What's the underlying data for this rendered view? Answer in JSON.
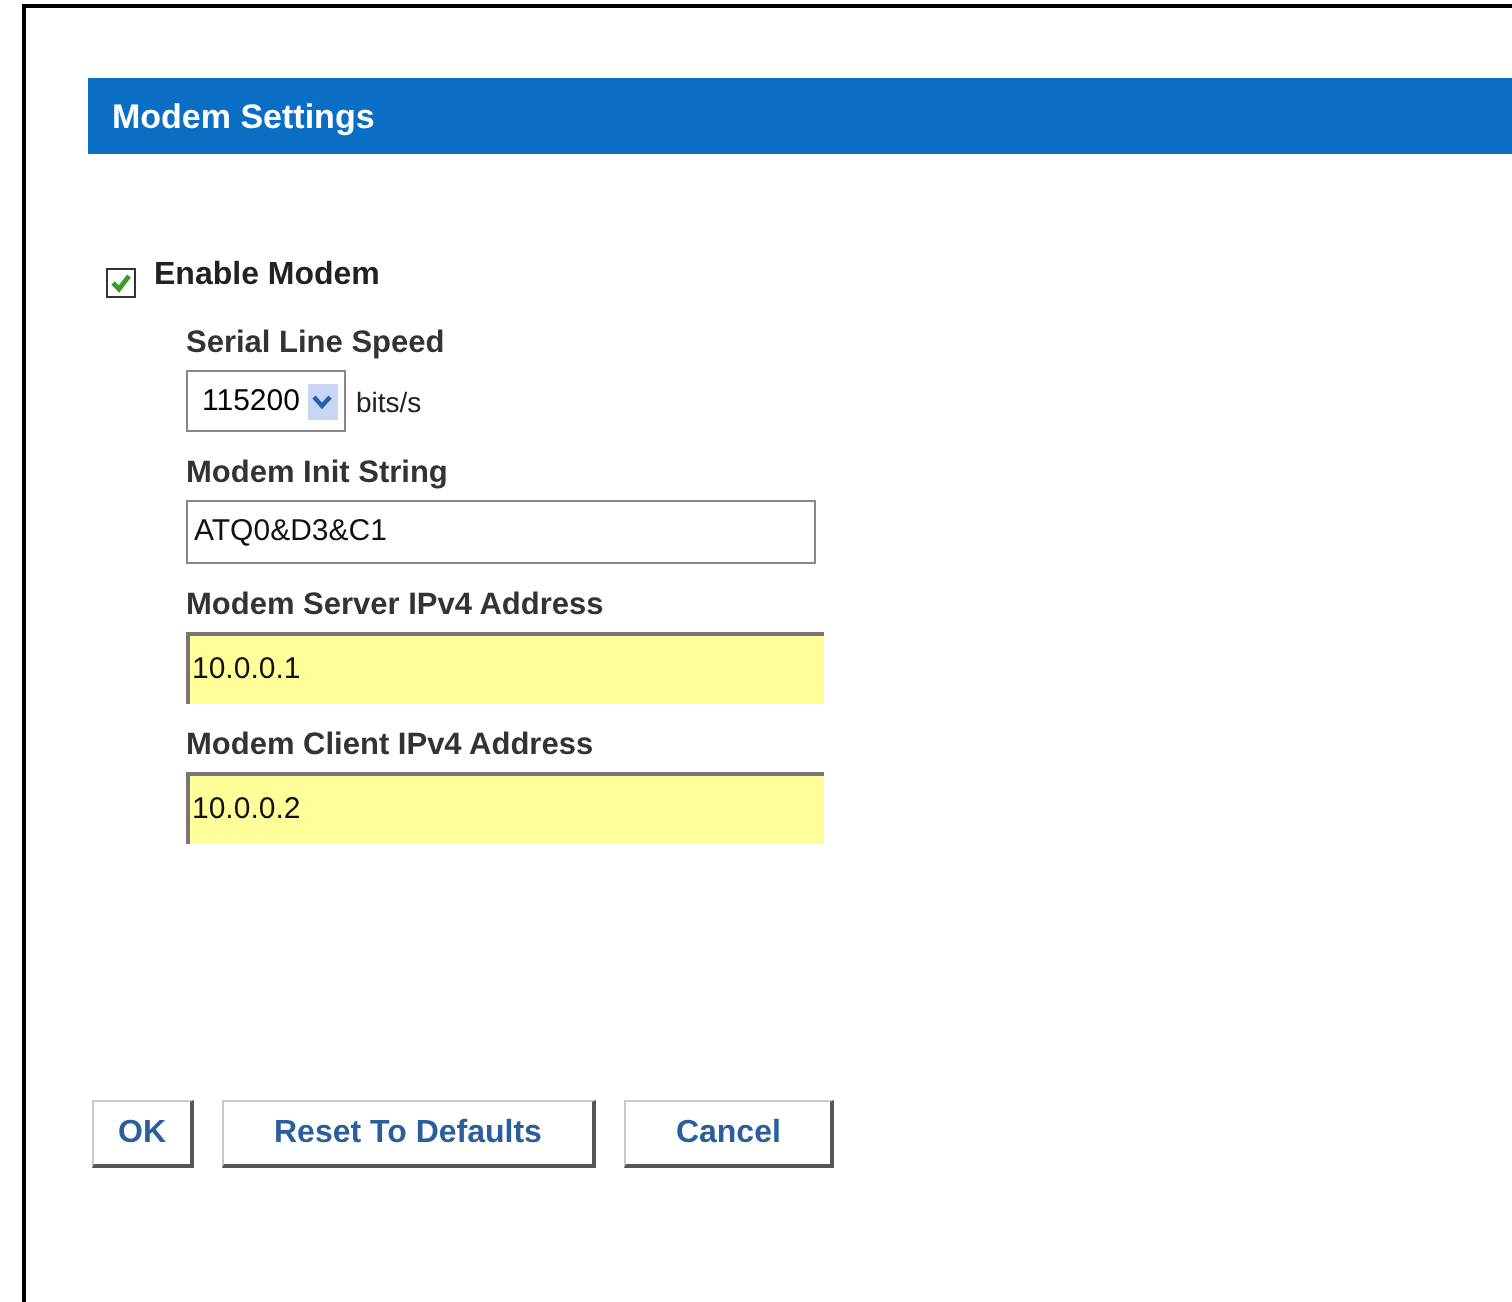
{
  "section": {
    "title": "Modem Settings"
  },
  "enable": {
    "label": "Enable Modem",
    "checked": true
  },
  "fields": [
    {
      "kind": "select",
      "label": "Serial Line Speed",
      "value": "115200",
      "unit": "bits/s"
    },
    {
      "kind": "text",
      "label": "Modem Init String",
      "value": "ATQ0&D3&C1"
    },
    {
      "kind": "address",
      "label": "Modem Server IPv4 Address",
      "value": "10.0.0.1"
    },
    {
      "kind": "address",
      "label": "Modem Client IPv4 Address",
      "value": "10.0.0.2"
    }
  ],
  "buttons": [
    "OK",
    "Reset To Defaults",
    "Cancel"
  ]
}
